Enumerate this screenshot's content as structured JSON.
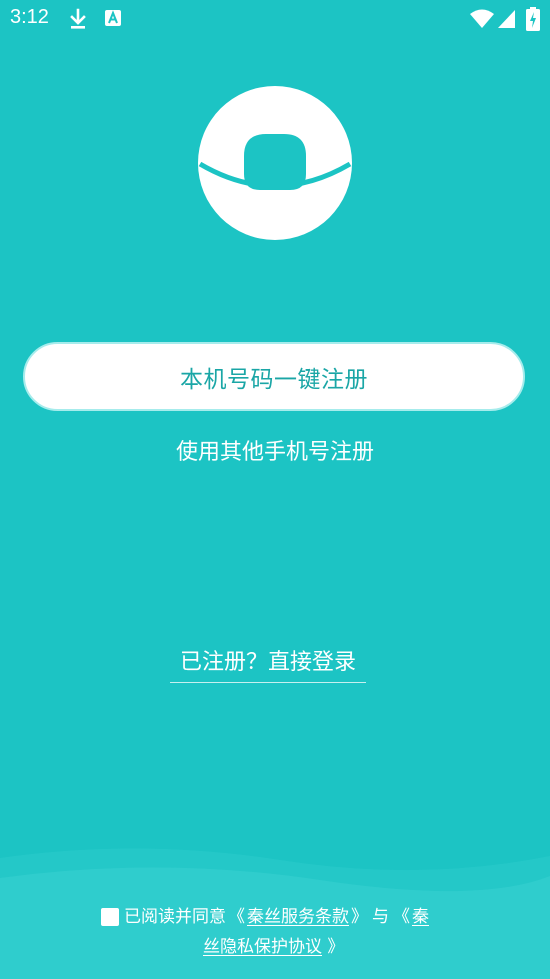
{
  "status_bar": {
    "time": "3:12",
    "icons": [
      "download-icon",
      "a-icon",
      "wifi-icon",
      "signal-icon",
      "battery-icon"
    ]
  },
  "brand": {
    "logo_icon": "app-logo-icon",
    "background_color": "#1cc4c4",
    "button_text_color": "#1aa6a6"
  },
  "actions": {
    "one_click_register": "本机号码一键注册",
    "other_phone_register": "使用其他手机号注册",
    "already_registered_login": "已注册？直接登录"
  },
  "agreement": {
    "prefix": "已阅读并同意",
    "open_quote_1": "《",
    "terms_link": "秦丝服务条款",
    "close_quote_1": "》",
    "conjunction": "与",
    "open_quote_2": "《",
    "privacy_link_part1": "秦",
    "privacy_link_part2": "丝隐私保护协议",
    "close_quote_2": "》",
    "checked": false
  }
}
